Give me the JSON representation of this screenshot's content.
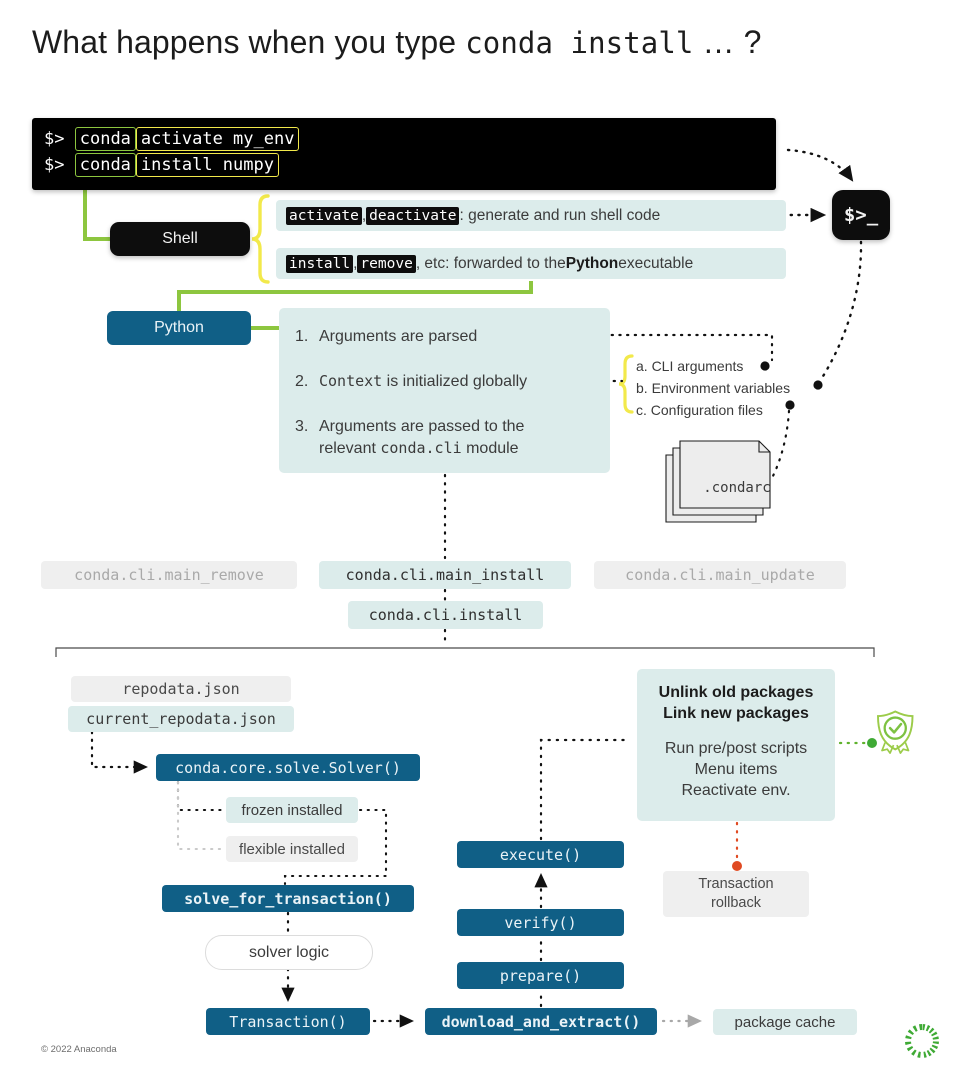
{
  "title": {
    "prefix": "What happens when you type ",
    "code": "conda install",
    "suffix": " … ?"
  },
  "terminal": {
    "line1": {
      "prompt": "$>",
      "cmd": "conda",
      "args": "activate my_env"
    },
    "line2": {
      "prompt": "$>",
      "cmd": "conda",
      "args": "install numpy"
    }
  },
  "shell": {
    "box_label": "Shell",
    "desc1": {
      "code1": "activate",
      "sep1": ", ",
      "code2": "deactivate",
      "tail": ": generate and run shell code"
    },
    "desc2": {
      "code1": "install",
      "sep1": ", ",
      "code2": "remove",
      "mid": ", etc: forwarded to the ",
      "strong": "Python",
      "tail": " executable"
    },
    "prompt_icon": "$>_"
  },
  "python": {
    "box_label": "Python",
    "steps": [
      {
        "num": "1.",
        "text": "Arguments are parsed"
      },
      {
        "num": "2.",
        "code": "Context",
        "text": " is initialized globally"
      },
      {
        "num": "3.",
        "text_a": "Arguments are passed to the",
        "text_b": "relevant ",
        "code": "conda.cli",
        "text_c": " module"
      }
    ],
    "context_sources": [
      "a. CLI arguments",
      "b. Environment variables",
      "c. Configuration files"
    ],
    "condarc_label": ".condarc"
  },
  "modules": {
    "main_remove": "conda.cli.main_remove",
    "main_install": "conda.cli.main_install",
    "main_update": "conda.cli.main_update",
    "cli_install": "conda.cli.install"
  },
  "solve": {
    "repodata": "repodata.json",
    "current_repodata": "current_repodata.json",
    "solver": "conda.core.solve.Solver()",
    "frozen": "frozen installed",
    "flexible": "flexible installed",
    "solve_for_transaction": "solve_for_transaction()",
    "solver_logic": "solver logic",
    "transaction": "Transaction()"
  },
  "execute": {
    "execute": "execute()",
    "verify": "verify()",
    "prepare": "prepare()",
    "download_and_extract": "download_and_extract()",
    "package_cache": "package cache"
  },
  "link": {
    "header_line1": "Unlink old packages",
    "header_line2": "Link new packages",
    "sub_line1": "Run pre/post scripts",
    "sub_line2": "Menu items",
    "sub_line3": "Reactivate env.",
    "rollback_line1": "Transaction",
    "rollback_line2": "rollback"
  },
  "footer": {
    "copyright": "© 2022 Anaconda"
  },
  "colors": {
    "brand_green": "#5fb22d",
    "accent_green": "#8dc63f",
    "accent_yellow": "#f2e94b",
    "deep_blue": "#105f86",
    "light_teal": "#dceceb",
    "light_grey": "#efefef",
    "red": "#e04a22",
    "black": "#0d0d0d"
  }
}
